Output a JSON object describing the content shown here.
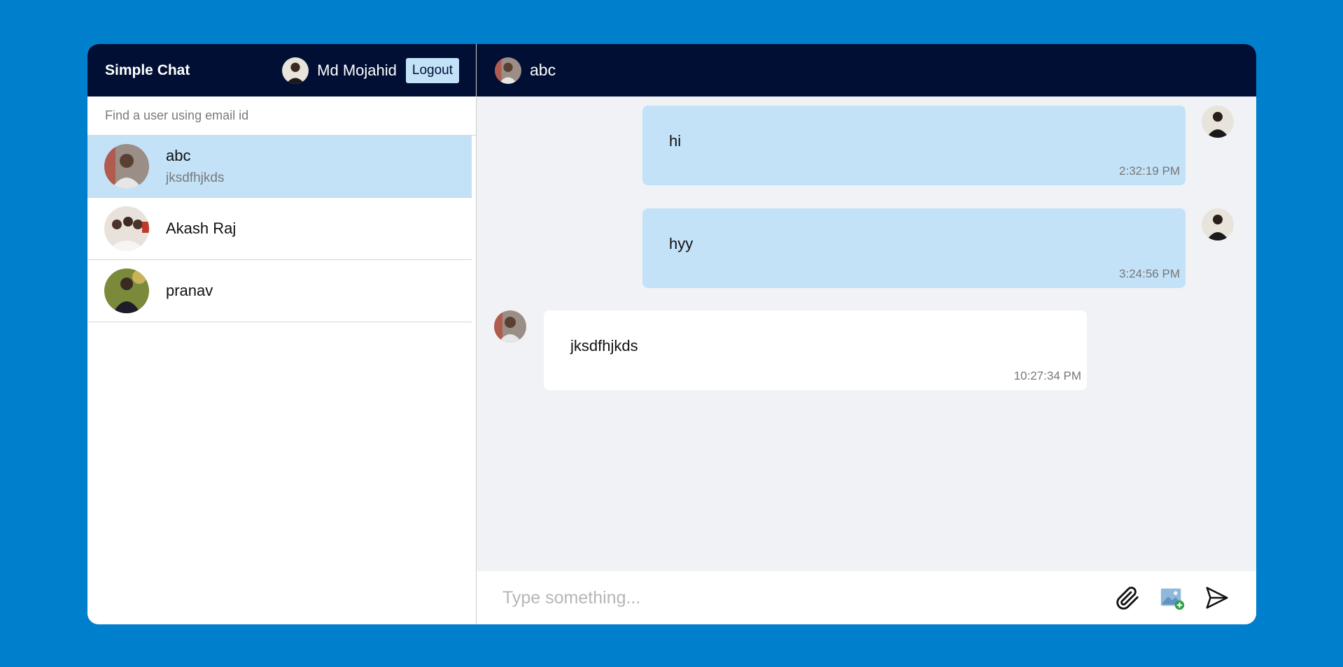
{
  "sidebar": {
    "app_title": "Simple Chat",
    "current_user": {
      "name": "Md Mojahid",
      "avatar_icon": "user-avatar-icon"
    },
    "logout_label": "Logout",
    "search_placeholder": "Find a user using email id",
    "users": [
      {
        "name": "abc",
        "last_message": "jksdfhjkds",
        "active": true
      },
      {
        "name": "Akash Raj",
        "last_message": "",
        "active": false
      },
      {
        "name": "pranav",
        "last_message": "",
        "active": false
      }
    ]
  },
  "chat": {
    "header_name": "abc",
    "messages": [
      {
        "text": "hi",
        "time": "2:32:19 PM",
        "owner": "me"
      },
      {
        "text": "hyy",
        "time": "3:24:56 PM",
        "owner": "me"
      },
      {
        "text": "jksdfhjkds",
        "time": "10:27:34 PM",
        "owner": "them"
      }
    ],
    "composer_placeholder": "Type something...",
    "icons": [
      "paperclip-icon",
      "image-add-icon",
      "send-icon"
    ]
  },
  "colors": {
    "background": "#0080cc",
    "header": "#000f33",
    "active_item": "#c3e2f8",
    "chat_bg": "#f0f2f5",
    "my_bubble": "#c3e2f8",
    "their_bubble": "#ffffff"
  }
}
